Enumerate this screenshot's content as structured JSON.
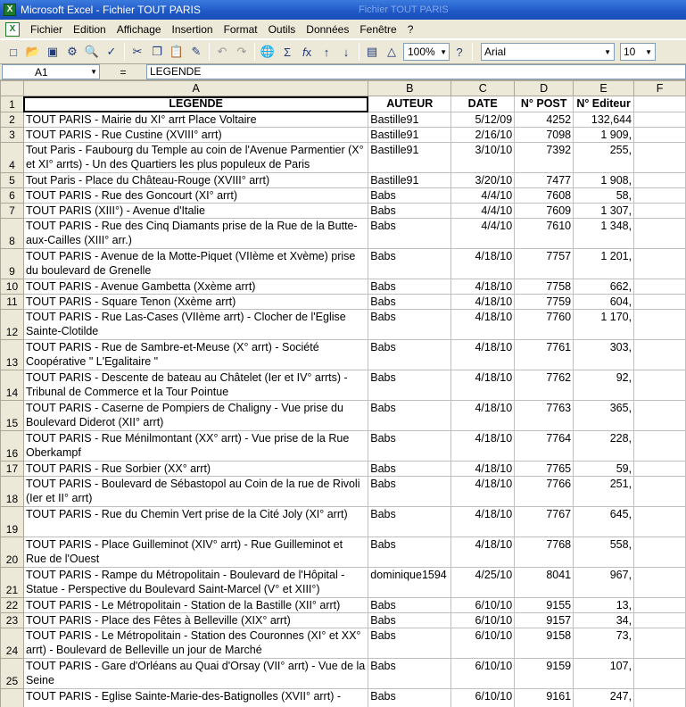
{
  "window": {
    "title": "Microsoft Excel - Fichier TOUT PARIS",
    "ghost_title": "Fichier TOUT PARIS"
  },
  "menu": [
    "Fichier",
    "Edition",
    "Affichage",
    "Insertion",
    "Format",
    "Outils",
    "Données",
    "Fenêtre",
    "?"
  ],
  "toolbar": {
    "zoom": "100%",
    "font": "Arial",
    "size": "10"
  },
  "formula_bar": {
    "name_box": "A1",
    "equals": "=",
    "content": "LEGENDE"
  },
  "columns": [
    "A",
    "B",
    "C",
    "D",
    "E",
    "F"
  ],
  "headers": [
    "LEGENDE",
    "AUTEUR",
    "DATE",
    "N° POST",
    "N° Editeur"
  ],
  "rows": [
    {
      "n": "2",
      "legende": "TOUT PARIS - Mairie du XI° arrt Place Voltaire",
      "auteur": "Bastille91",
      "date": "5/12/09",
      "post": "4252",
      "editeur": "132,644"
    },
    {
      "n": "3",
      "legende": "TOUT PARIS - Rue Custine (XVIII° arrt)",
      "auteur": "Bastille91",
      "date": "2/16/10",
      "post": "7098",
      "editeur": "1 909,"
    },
    {
      "n": "4",
      "legende": "Tout Paris - Faubourg du Temple au coin de l'Avenue Parmentier (X° et XI° arrts) - Un des Quartiers les plus populeux de Paris",
      "auteur": "Bastille91",
      "date": "3/10/10",
      "post": "7392",
      "editeur": "255,"
    },
    {
      "n": "5",
      "legende": "Tout Paris - Place du Château-Rouge (XVIII° arrt)",
      "auteur": "Bastille91",
      "date": "3/20/10",
      "post": "7477",
      "editeur": "1 908,"
    },
    {
      "n": "6",
      "legende": "TOUT PARIS - Rue des Goncourt (XI° arrt)",
      "auteur": "Babs",
      "date": "4/4/10",
      "post": "7608",
      "editeur": "58,"
    },
    {
      "n": "7",
      "legende": "TOUT PARIS (XIII°) - Avenue d'Italie",
      "auteur": "Babs",
      "date": "4/4/10",
      "post": "7609",
      "editeur": "1 307,"
    },
    {
      "n": "8",
      "legende": "TOUT PARIS - Rue des Cinq Diamants prise de la Rue de la Butte-aux-Cailles (XIII° arr.)",
      "auteur": "Babs",
      "date": "4/4/10",
      "post": "7610",
      "editeur": "1 348,"
    },
    {
      "n": "9",
      "legende": "TOUT PARIS - Avenue de la Motte-Piquet (VIIème et Xvème) prise du boulevard de Grenelle",
      "auteur": "Babs",
      "date": "4/18/10",
      "post": "7757",
      "editeur": "1 201,"
    },
    {
      "n": "10",
      "legende": "TOUT PARIS - Avenue Gambetta (Xxème arrt)",
      "auteur": "Babs",
      "date": "4/18/10",
      "post": "7758",
      "editeur": "662,"
    },
    {
      "n": "11",
      "legende": "TOUT PARIS - Square Tenon (Xxème arrt)",
      "auteur": "Babs",
      "date": "4/18/10",
      "post": "7759",
      "editeur": "604,"
    },
    {
      "n": "12",
      "legende": "TOUT PARIS - Rue Las-Cases (VIIème arrt) - Clocher de l'Eglise Sainte-Clotilde",
      "auteur": "Babs",
      "date": "4/18/10",
      "post": "7760",
      "editeur": "1 170,"
    },
    {
      "n": "13",
      "legende": "TOUT PARIS - Rue de Sambre-et-Meuse (X° arrt) - Société Coopérative \" L'Egalitaire \"",
      "auteur": "Babs",
      "date": "4/18/10",
      "post": "7761",
      "editeur": "303,"
    },
    {
      "n": "14",
      "legende": "TOUT PARIS - Descente de bateau au Châtelet (Ier et IV° arrts) - Tribunal de Commerce et la Tour Pointue",
      "auteur": "Babs",
      "date": "4/18/10",
      "post": "7762",
      "editeur": "92,"
    },
    {
      "n": "15",
      "legende": "TOUT PARIS - Caserne de Pompiers de Chaligny - Vue prise du Boulevard Diderot (XII° arrt)",
      "auteur": "Babs",
      "date": "4/18/10",
      "post": "7763",
      "editeur": "365,"
    },
    {
      "n": "16",
      "legende": "TOUT PARIS - Rue Ménilmontant (XX° arrt) - Vue prise de la Rue Oberkampf",
      "auteur": "Babs",
      "date": "4/18/10",
      "post": "7764",
      "editeur": "228,"
    },
    {
      "n": "17",
      "legende": "TOUT PARIS - Rue Sorbier (XX° arrt)",
      "auteur": "Babs",
      "date": "4/18/10",
      "post": "7765",
      "editeur": "59,"
    },
    {
      "n": "18",
      "legende": "TOUT PARIS - Boulevard de Sébastopol au Coin de la rue de Rivoli (Ier et II° arrt)",
      "auteur": "Babs",
      "date": "4/18/10",
      "post": "7766",
      "editeur": "251,"
    },
    {
      "n": "19",
      "legende": "TOUT PARIS - Rue du Chemin Vert prise de la Cité Joly (XI° arrt)",
      "auteur": "Babs",
      "date": "4/18/10",
      "post": "7767",
      "editeur": "645,"
    },
    {
      "n": "20",
      "legende": "TOUT PARIS - Place Guilleminot (XIV° arrt) - Rue Guilleminot et Rue de l'Ouest",
      "auteur": "Babs",
      "date": "4/18/10",
      "post": "7768",
      "editeur": "558,"
    },
    {
      "n": "21",
      "legende": "TOUT PARIS - Rampe du Métropolitain - Boulevard de l'Hôpital - Statue - Perspective du Boulevard Saint-Marcel (V° et XIII°)",
      "auteur": "dominique1594",
      "date": "4/25/10",
      "post": "8041",
      "editeur": "967,"
    },
    {
      "n": "22",
      "legende": "TOUT PARIS - Le Métropolitain - Station de la Bastille (XII° arrt)",
      "auteur": "Babs",
      "date": "6/10/10",
      "post": "9155",
      "editeur": "13,"
    },
    {
      "n": "23",
      "legende": "TOUT PARIS - Place des Fêtes à Belleville (XIX° arrt)",
      "auteur": "Babs",
      "date": "6/10/10",
      "post": "9157",
      "editeur": "34,"
    },
    {
      "n": "24",
      "legende": "TOUT PARIS - Le Métropolitain - Station des Couronnes (XI° et XX° arrt) - Boulevard de Belleville un jour de Marché",
      "auteur": "Babs",
      "date": "6/10/10",
      "post": "9158",
      "editeur": "73,"
    },
    {
      "n": "25",
      "legende": "TOUT PARIS - Gare d'Orléans au Quai d'Orsay (VII° arrt) - Vue de la Seine",
      "auteur": "Babs",
      "date": "6/10/10",
      "post": "9159",
      "editeur": "107,"
    },
    {
      "n": "26",
      "legende": "TOUT PARIS - Eglise Sainte-Marie-des-Batignolles (XVII° arrt) -",
      "auteur": "Babs",
      "date": "6/10/10",
      "post": "9161",
      "editeur": "247,"
    }
  ]
}
